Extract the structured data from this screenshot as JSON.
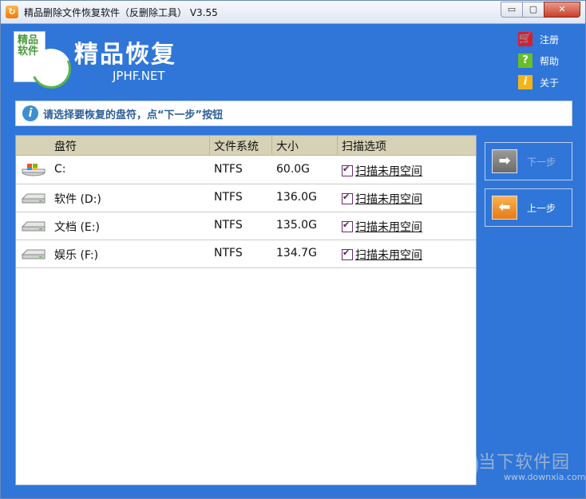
{
  "window": {
    "title": "精品删除文件恢复软件（反删除工具） V3.55",
    "controls": {
      "minimize": "▭",
      "maximize": "▢",
      "close": "✕"
    }
  },
  "header": {
    "logo_text": "精品软件",
    "brand_title": "精品恢复",
    "brand_subtitle": "JPHF.NET",
    "links": [
      {
        "label": "注册",
        "icon": "cart-icon"
      },
      {
        "label": "帮助",
        "icon": "question-icon"
      },
      {
        "label": "关于",
        "icon": "info-icon"
      }
    ]
  },
  "notice": {
    "text": "请选择要恢复的盘符，点“下一步”按钮"
  },
  "table": {
    "columns": [
      "盘符",
      "文件系统",
      "大小",
      "扫描选项"
    ],
    "rows": [
      {
        "drive": "C:",
        "fs": "NTFS",
        "size": "60.0G",
        "scan": "扫描未用空间",
        "icon": "windows-drive-icon"
      },
      {
        "drive": "软件 (D:)",
        "fs": "NTFS",
        "size": "136.0G",
        "scan": "扫描未用空间",
        "icon": "hard-drive-icon"
      },
      {
        "drive": "文档 (E:)",
        "fs": "NTFS",
        "size": "135.0G",
        "scan": "扫描未用空间",
        "icon": "hard-drive-icon"
      },
      {
        "drive": "娱乐 (F:)",
        "fs": "NTFS",
        "size": "134.7G",
        "scan": "扫描未用空间",
        "icon": "hard-drive-icon"
      }
    ]
  },
  "buttons": {
    "next": "下一步",
    "prev": "上一步"
  },
  "watermark": {
    "text": "当下软件园",
    "url": "www.downxia.com"
  },
  "colors": {
    "background": "#2f76d8",
    "table_header": "#d5d2b5",
    "notice_text": "#2d5e9a"
  }
}
